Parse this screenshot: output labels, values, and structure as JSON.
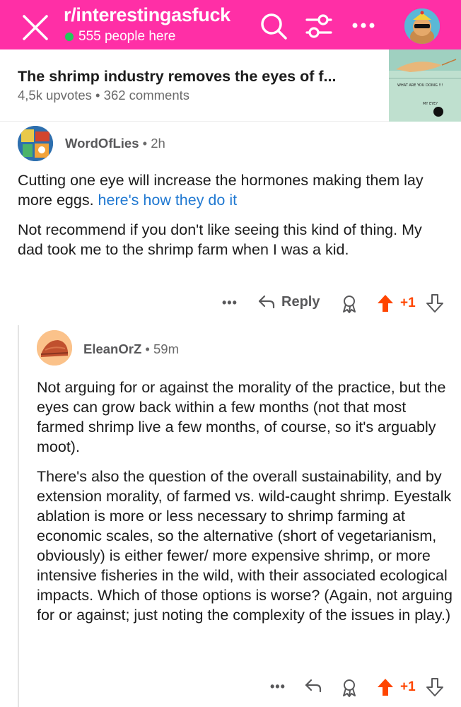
{
  "header": {
    "subreddit": "r/interestingasfuck",
    "online_count": "555 people here",
    "colors": {
      "background": "#ff2fa6",
      "online_dot": "#20c95a"
    },
    "icons": [
      "close-icon",
      "search-icon",
      "filter-icon",
      "more-icon",
      "user-avatar"
    ]
  },
  "post": {
    "title": "The shrimp industry removes the eyes of f...",
    "meta": "4,5k upvotes • 362 comments",
    "thumbnail_text": {
      "line1": "WHAT ARE YOU DOING !!!",
      "line2": "MY EYE?"
    }
  },
  "comments": [
    {
      "author": "WordOfLies",
      "time": "• 2h",
      "paragraph1_text": "Cutting one eye will increase the hormones making them lay more eggs.",
      "paragraph1_link": "here's how they do it",
      "paragraph2": "Not recommend if you don't like seeing this kind of thing. My dad took me to the shrimp farm when I was a kid.",
      "actions": {
        "more": "•••",
        "reply": "Reply",
        "votes": "+1"
      }
    },
    {
      "author": "ElеanOrZ",
      "time": "• 59m",
      "paragraph1": "Not arguing for or against the morality of the practice, but the eyes can grow back within a few months (not that most farmed shrimp live a few months, of course, so it's arguably moot).",
      "paragraph2": "There's also the question of the overall sustainability, and by extension morality, of farmed vs. wild-caught shrimp. Eyestalk ablation is more or less necessary to shrimp farming at economic scales, so the alternative (short of vegetarianism, obviously) is either fewer/ more expensive shrimp, or more intensive fisheries in the wild, with their associated ecological impacts. Which of those options is worse? (Again, not arguing for or against; just noting the complexity of the issues in play.)",
      "actions": {
        "more": "•••",
        "votes": "+1"
      }
    }
  ],
  "colors": {
    "upvote_active": "#ff4500",
    "link": "#1f78d1"
  }
}
